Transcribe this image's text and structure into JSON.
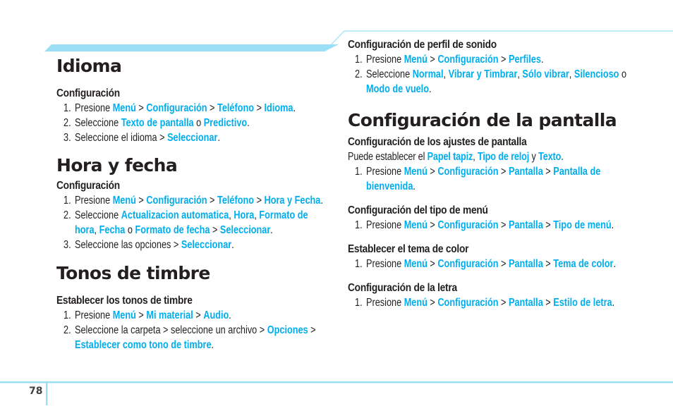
{
  "page_number": "78",
  "accent_color": "#00aeef",
  "rule_color": "#9bdff5",
  "left_column": {
    "sections": [
      {
        "title": "Idioma",
        "subsections": [
          {
            "heading": "Configuración",
            "steps": [
              {
                "num": "1.",
                "parts": [
                  {
                    "t": "Presione "
                  },
                  {
                    "t": "Menú",
                    "hl": true
                  },
                  {
                    "t": " > "
                  },
                  {
                    "t": "Configuración",
                    "hl": true
                  },
                  {
                    "t": " > "
                  },
                  {
                    "t": "Teléfono",
                    "hl": true
                  },
                  {
                    "t": " > "
                  },
                  {
                    "t": "Idioma",
                    "hl": true
                  },
                  {
                    "t": "."
                  }
                ]
              },
              {
                "num": "2.",
                "parts": [
                  {
                    "t": "Seleccione "
                  },
                  {
                    "t": "Texto de pantalla",
                    "hl": true
                  },
                  {
                    "t": " o "
                  },
                  {
                    "t": "Predictivo",
                    "hl": true
                  },
                  {
                    "t": "."
                  }
                ]
              },
              {
                "num": "3.",
                "parts": [
                  {
                    "t": "Seleccione el idioma > "
                  },
                  {
                    "t": "Seleccionar",
                    "hl": true
                  },
                  {
                    "t": "."
                  }
                ]
              }
            ]
          }
        ]
      },
      {
        "title": "Hora y fecha",
        "subsections": [
          {
            "heading": "Configuración",
            "steps": [
              {
                "num": "1.",
                "parts": [
                  {
                    "t": "Presione "
                  },
                  {
                    "t": "Menú",
                    "hl": true
                  },
                  {
                    "t": " > "
                  },
                  {
                    "t": "Configuración",
                    "hl": true
                  },
                  {
                    "t": " > "
                  },
                  {
                    "t": "Teléfono",
                    "hl": true
                  },
                  {
                    "t": " > "
                  },
                  {
                    "t": "Hora y Fecha",
                    "hl": true
                  },
                  {
                    "t": "."
                  }
                ]
              },
              {
                "num": "2.",
                "parts": [
                  {
                    "t": "Seleccione "
                  },
                  {
                    "t": "Actualizacion automatica",
                    "hl": true
                  },
                  {
                    "t": ", "
                  },
                  {
                    "t": "Hora",
                    "hl": true
                  },
                  {
                    "t": ", "
                  },
                  {
                    "t": "Formato de hora",
                    "hl": true
                  },
                  {
                    "t": ", "
                  },
                  {
                    "t": "Fecha",
                    "hl": true
                  },
                  {
                    "t": " o "
                  },
                  {
                    "t": "Formato de fecha",
                    "hl": true
                  },
                  {
                    "t": " > "
                  },
                  {
                    "t": "Seleccionar",
                    "hl": true
                  },
                  {
                    "t": "."
                  }
                ]
              },
              {
                "num": "3.",
                "parts": [
                  {
                    "t": "Seleccione las opciones > "
                  },
                  {
                    "t": "Seleccionar",
                    "hl": true
                  },
                  {
                    "t": "."
                  }
                ]
              }
            ]
          }
        ]
      },
      {
        "title": "Tonos de timbre",
        "subsections": [
          {
            "heading": "Establecer los tonos de timbre",
            "steps": [
              {
                "num": "1.",
                "parts": [
                  {
                    "t": "Presione "
                  },
                  {
                    "t": "Menú",
                    "hl": true
                  },
                  {
                    "t": " > "
                  },
                  {
                    "t": "Mi material",
                    "hl": true
                  },
                  {
                    "t": " > "
                  },
                  {
                    "t": "Audio",
                    "hl": true
                  },
                  {
                    "t": "."
                  }
                ]
              },
              {
                "num": "2.",
                "parts": [
                  {
                    "t": "Seleccione la carpeta > seleccione un archivo > "
                  },
                  {
                    "t": "Opciones",
                    "hl": true
                  },
                  {
                    "t": " > "
                  },
                  {
                    "t": "Establecer como tono de timbre",
                    "hl": true
                  },
                  {
                    "t": "."
                  }
                ]
              }
            ]
          }
        ]
      }
    ]
  },
  "right_column": {
    "top_subsection": {
      "heading": "Configuración de perfil de sonido",
      "steps": [
        {
          "num": "1.",
          "parts": [
            {
              "t": "Presione "
            },
            {
              "t": "Menú",
              "hl": true
            },
            {
              "t": " > "
            },
            {
              "t": "Configuración",
              "hl": true
            },
            {
              "t": " > "
            },
            {
              "t": "Perfiles",
              "hl": true
            },
            {
              "t": "."
            }
          ]
        },
        {
          "num": "2.",
          "parts": [
            {
              "t": "Seleccione "
            },
            {
              "t": "Normal",
              "hl": true
            },
            {
              "t": ", "
            },
            {
              "t": "Vibrar y Timbrar",
              "hl": true
            },
            {
              "t": ", "
            },
            {
              "t": "Sólo vibrar",
              "hl": true
            },
            {
              "t": ", "
            },
            {
              "t": "Silencioso",
              "hl": true
            },
            {
              "t": " o "
            },
            {
              "t": "Modo de vuelo",
              "hl": true
            },
            {
              "t": "."
            }
          ]
        }
      ]
    },
    "section": {
      "title": "Configuración de la pantalla",
      "subsections": [
        {
          "heading": "Configuración de los ajustes de pantalla",
          "intro": [
            {
              "t": "Puede establecer el "
            },
            {
              "t": "Papel tapiz",
              "hl": true
            },
            {
              "t": ", "
            },
            {
              "t": "Tipo de reloj",
              "hl": true
            },
            {
              "t": " y "
            },
            {
              "t": "Texto",
              "hl": true
            },
            {
              "t": "."
            }
          ],
          "steps": [
            {
              "num": "1.",
              "parts": [
                {
                  "t": "Presione "
                },
                {
                  "t": "Menú",
                  "hl": true
                },
                {
                  "t": " > "
                },
                {
                  "t": "Configuración",
                  "hl": true
                },
                {
                  "t": " > "
                },
                {
                  "t": "Pantalla",
                  "hl": true
                },
                {
                  "t": " > "
                },
                {
                  "t": "Pantalla de bienvenida",
                  "hl": true
                },
                {
                  "t": "."
                }
              ]
            }
          ]
        },
        {
          "heading": "Configuración del tipo de menú",
          "steps": [
            {
              "num": "1.",
              "parts": [
                {
                  "t": "Presione "
                },
                {
                  "t": "Menú",
                  "hl": true
                },
                {
                  "t": " > "
                },
                {
                  "t": "Configuración",
                  "hl": true
                },
                {
                  "t": " > "
                },
                {
                  "t": "Pantalla",
                  "hl": true
                },
                {
                  "t": " > "
                },
                {
                  "t": "Tipo de menú",
                  "hl": true
                },
                {
                  "t": "."
                }
              ]
            }
          ]
        },
        {
          "heading": "Establecer el tema de color",
          "steps": [
            {
              "num": "1.",
              "parts": [
                {
                  "t": "Presione "
                },
                {
                  "t": "Menú",
                  "hl": true
                },
                {
                  "t": " > "
                },
                {
                  "t": "Configuración",
                  "hl": true
                },
                {
                  "t": " > "
                },
                {
                  "t": "Pantalla",
                  "hl": true
                },
                {
                  "t": " > "
                },
                {
                  "t": "Tema de color",
                  "hl": true
                },
                {
                  "t": "."
                }
              ]
            }
          ]
        },
        {
          "heading": "Configuración de la letra",
          "steps": [
            {
              "num": "1.",
              "parts": [
                {
                  "t": "Presione "
                },
                {
                  "t": "Menú",
                  "hl": true
                },
                {
                  "t": " > "
                },
                {
                  "t": "Configuración",
                  "hl": true
                },
                {
                  "t": " > "
                },
                {
                  "t": "Pantalla",
                  "hl": true
                },
                {
                  "t": " > "
                },
                {
                  "t": "Estilo de letra",
                  "hl": true
                },
                {
                  "t": "."
                }
              ]
            }
          ]
        }
      ]
    }
  }
}
